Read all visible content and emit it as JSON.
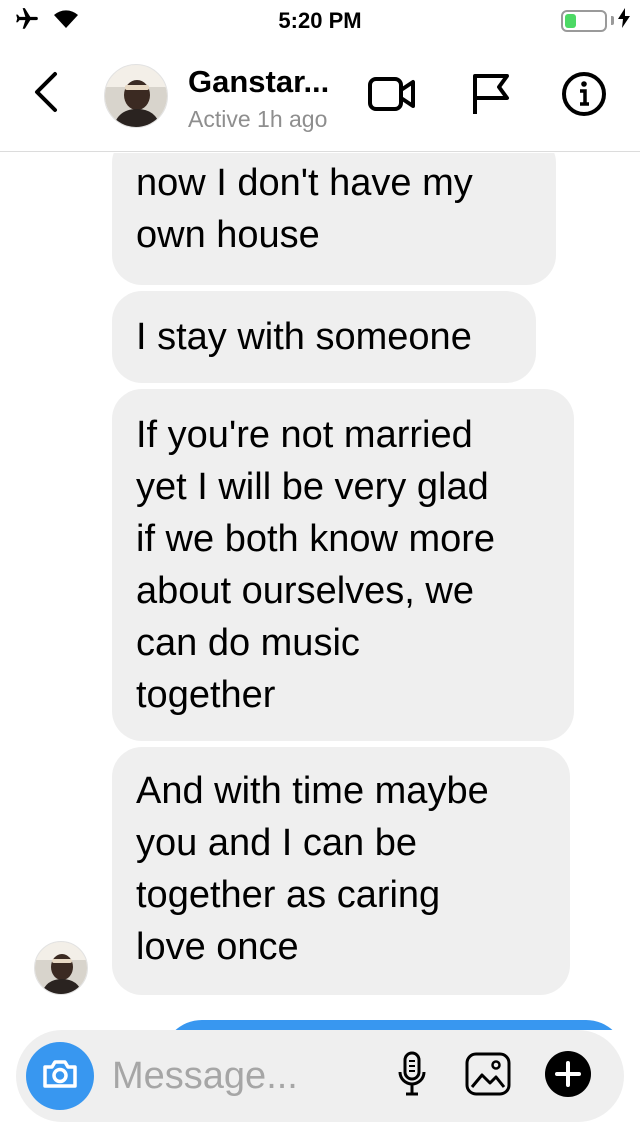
{
  "status_bar": {
    "time": "5:20 PM",
    "battery_level": 0.3,
    "battery_color": "#4cd964",
    "icons": [
      "airplane-icon",
      "wifi-icon",
      "battery-icon",
      "charging-bolt-icon"
    ]
  },
  "header": {
    "contact_name": "Ganstar...",
    "contact_status": "Active 1h ago",
    "icons": [
      "back-chevron-icon",
      "video-camera-icon",
      "flag-icon",
      "info-icon"
    ]
  },
  "messages": [
    {
      "direction": "received",
      "text": "now I don't have my\nown house"
    },
    {
      "direction": "received",
      "text": "I stay with someone"
    },
    {
      "direction": "received",
      "text": "If you're not married\nyet I will be very glad\nif we both know more\nabout ourselves, we\ncan do music\ntogether"
    },
    {
      "direction": "received",
      "text": "And with time maybe\nyou and I can be\ntogether as caring\nlove once"
    },
    {
      "direction": "sent",
      "text": ""
    }
  ],
  "composer": {
    "placeholder": "Message...",
    "value": "",
    "icons": [
      "camera-icon",
      "microphone-icon",
      "gallery-icon",
      "plus-icon"
    ]
  },
  "colors": {
    "accent": "#3897f0",
    "received_bubble": "#efefef",
    "muted_text": "#8e8e8e"
  }
}
